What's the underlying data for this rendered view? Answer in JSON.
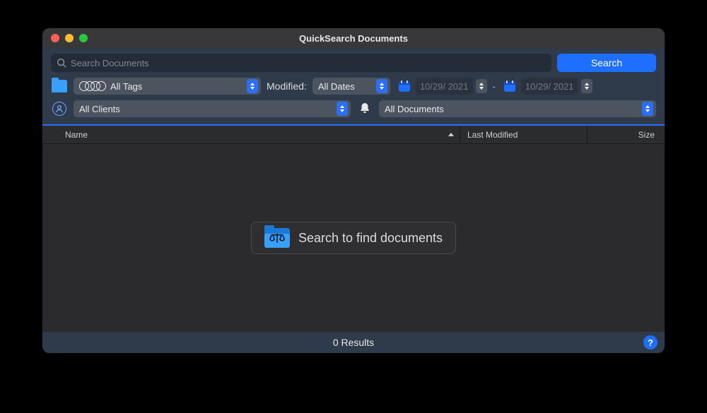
{
  "window": {
    "title": "QuickSearch Documents"
  },
  "toolbar": {
    "search_placeholder": "Search Documents",
    "search_button": "Search",
    "tags_value": "All Tags",
    "modified_label": "Modified:",
    "dates_value": "All Dates",
    "date_from": "10/29/ 2021",
    "date_to": "10/29/ 2021",
    "date_sep": "-",
    "clients_value": "All Clients",
    "doctype_value": "All Documents"
  },
  "columns": {
    "name": "Name",
    "modified": "Last Modified",
    "size": "Size"
  },
  "placeholder": {
    "message": "Search to find documents"
  },
  "footer": {
    "results": "0 Results",
    "help": "?"
  }
}
